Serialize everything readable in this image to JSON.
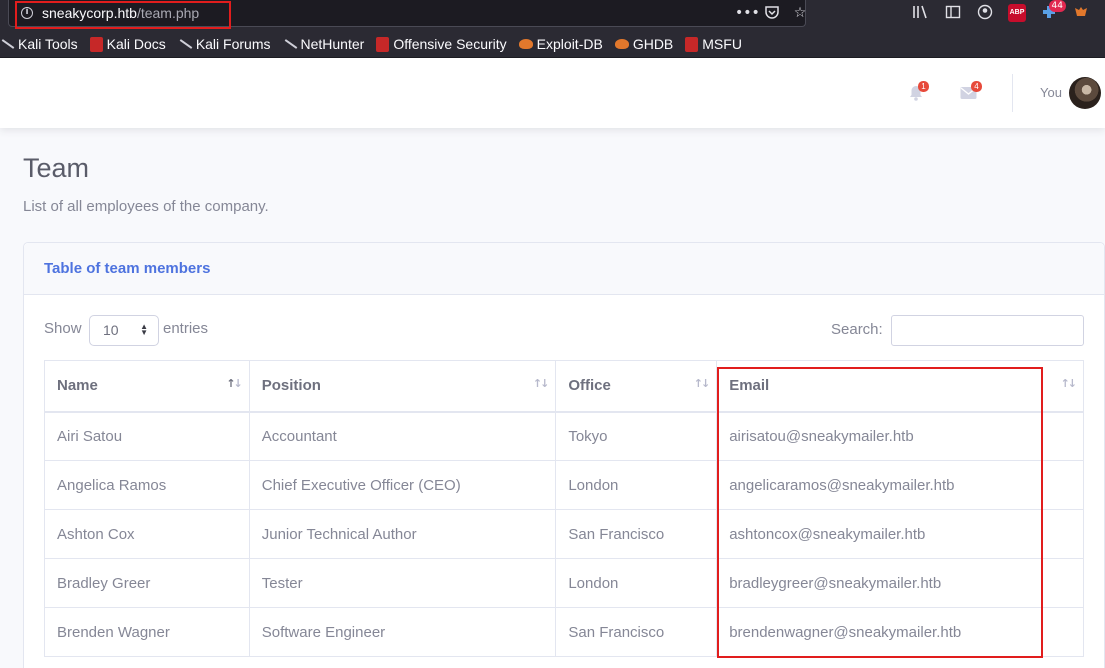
{
  "browser": {
    "url_host": "sneakycorp.htb",
    "url_path": "/team.php",
    "extension_badge": "44",
    "bookmarks": [
      "Kali Tools",
      "Kali Docs",
      "Kali Forums",
      "NetHunter",
      "Offensive Security",
      "Exploit-DB",
      "GHDB",
      "MSFU"
    ],
    "abp_label": "ABP"
  },
  "topbar": {
    "alerts_count": "1",
    "messages_count": "4",
    "user_label": "You"
  },
  "page": {
    "title": "Team",
    "subtitle": "List of all employees of the company."
  },
  "card": {
    "title": "Table of team members",
    "show_label": "Show",
    "entries_value": "10",
    "entries_label": "entries",
    "search_label": "Search:"
  },
  "table": {
    "headers": [
      "Name",
      "Position",
      "Office",
      "Email"
    ],
    "rows": [
      [
        "Airi Satou",
        "Accountant",
        "Tokyo",
        "airisatou@sneakymailer.htb"
      ],
      [
        "Angelica Ramos",
        "Chief Executive Officer (CEO)",
        "London",
        "angelicaramos@sneakymailer.htb"
      ],
      [
        "Ashton Cox",
        "Junior Technical Author",
        "San Francisco",
        "ashtoncox@sneakymailer.htb"
      ],
      [
        "Bradley Greer",
        "Tester",
        "London",
        "bradleygreer@sneakymailer.htb"
      ],
      [
        "Brenden Wagner",
        "Software Engineer",
        "San Francisco",
        "brendenwagner@sneakymailer.htb"
      ]
    ]
  },
  "colors": {
    "primary": "#4e73df",
    "danger": "#e74a3b",
    "highlight": "#e11d1d"
  }
}
